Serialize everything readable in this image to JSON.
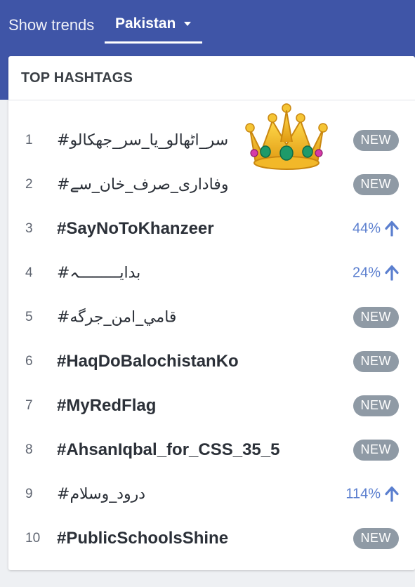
{
  "header": {
    "show_trends_label": "Show trends",
    "country_label": "Pakistan",
    "caret_icon": "caret-down-icon"
  },
  "card": {
    "title": "TOP HASHTAGS"
  },
  "sticker": {
    "icon": "crown-icon"
  },
  "hashtags": [
    {
      "rank": "1",
      "tag": "#سر_اٹھالو_یا_سر_جھکالو",
      "status": "NEW"
    },
    {
      "rank": "2",
      "tag": "#وفاداری_صرف_خان_سے",
      "status": "NEW"
    },
    {
      "rank": "3",
      "tag": "#SayNoToKhanzeer",
      "change": "44%"
    },
    {
      "rank": "4",
      "tag": "#بدایـــــــــہ",
      "change": "24%"
    },
    {
      "rank": "5",
      "tag": "#قامي_امن_جرگه",
      "status": "NEW"
    },
    {
      "rank": "6",
      "tag": "#HaqDoBalochistanKo",
      "status": "NEW"
    },
    {
      "rank": "7",
      "tag": "#MyRedFlag",
      "status": "NEW"
    },
    {
      "rank": "8",
      "tag": "#AhsanIqbal_for_CSS_35_5",
      "status": "NEW"
    },
    {
      "rank": "9",
      "tag": "#درود_وسلام",
      "change": "114%"
    },
    {
      "rank": "10",
      "tag": "#PublicSchoolsShine",
      "status": "NEW"
    }
  ],
  "colors": {
    "header_bg": "#3f55a7",
    "badge_bg": "#8f9aa5",
    "growth": "#5b7fcf"
  }
}
